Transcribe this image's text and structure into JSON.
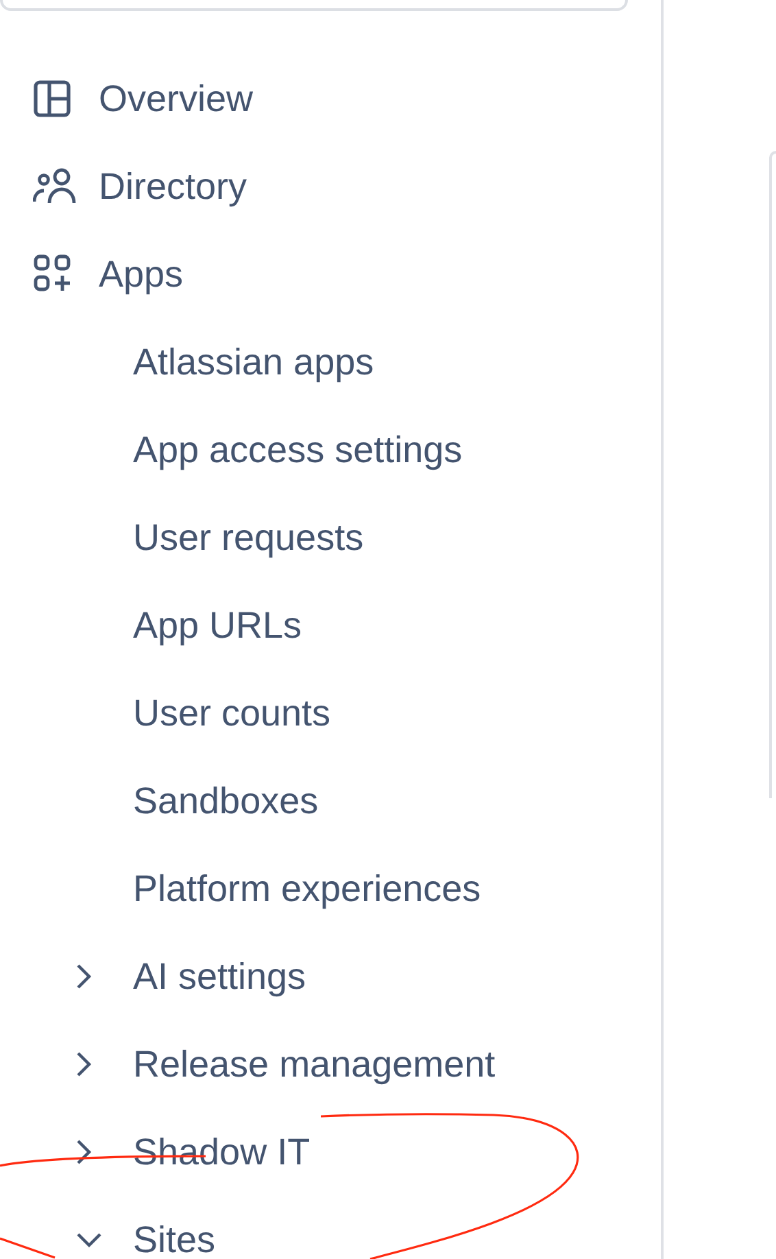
{
  "nav": [
    {
      "kind": "top",
      "label": "Overview"
    },
    {
      "kind": "top",
      "label": "Directory"
    },
    {
      "kind": "top",
      "label": "Apps"
    },
    {
      "kind": "sub",
      "label": "Atlassian apps"
    },
    {
      "kind": "sub",
      "label": "App access settings"
    },
    {
      "kind": "sub",
      "label": "User requests"
    },
    {
      "kind": "sub",
      "label": "App URLs"
    },
    {
      "kind": "sub",
      "label": "User counts"
    },
    {
      "kind": "sub",
      "label": "Sandboxes"
    },
    {
      "kind": "sub",
      "label": "Platform experiences"
    },
    {
      "kind": "group",
      "label": "AI settings",
      "expanded": false
    },
    {
      "kind": "group",
      "label": "Release management",
      "expanded": false
    },
    {
      "kind": "group",
      "label": "Shadow IT",
      "expanded": false
    },
    {
      "kind": "group",
      "label": "Sites",
      "expanded": true
    }
  ]
}
